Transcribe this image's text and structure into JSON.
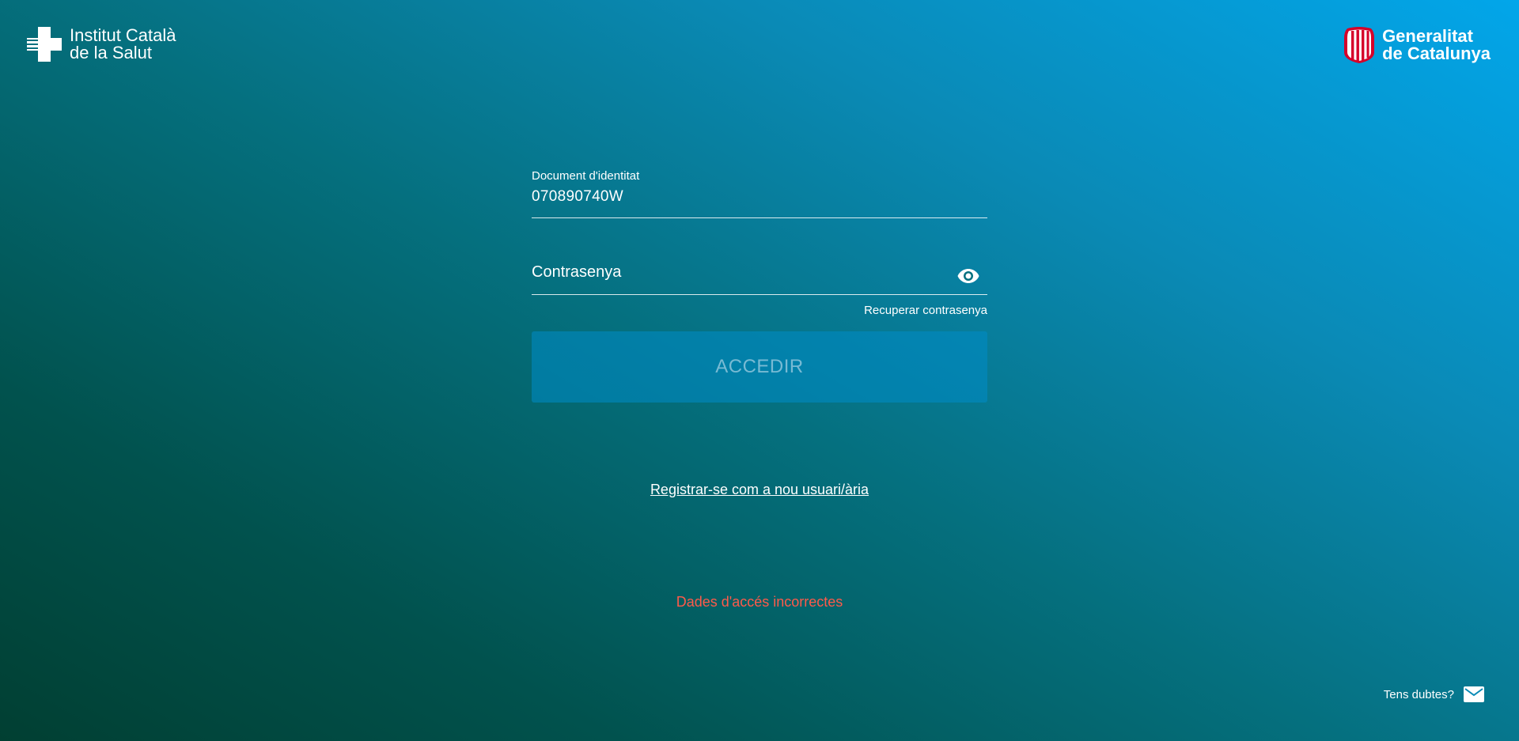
{
  "header": {
    "ics_logo": {
      "line1": "Institut Català",
      "line2": "de la Salut",
      "icon": "ics-cross-icon"
    },
    "generalitat_logo": {
      "line1": "Generalitat",
      "line2": "de Catalunya",
      "icon": "senyera-shield-icon"
    }
  },
  "form": {
    "document_label": "Document d'identitat",
    "document_value": "070890740W",
    "password_placeholder": "Contrasenya",
    "show_password_icon": "eye-icon",
    "recover_link": "Recuperar contrasenya",
    "submit_label": "ACCEDIR"
  },
  "register_link": "Registrar-se com a nou usuari/ària",
  "error_message": "Dades d'accés incorrectes",
  "help": {
    "label": "Tens dubtes?",
    "icon": "mail-icon"
  },
  "colors": {
    "background_start": "#013f32",
    "background_end": "#02a6ea",
    "error": "#ff5a4a",
    "button": "#0a86b8"
  }
}
